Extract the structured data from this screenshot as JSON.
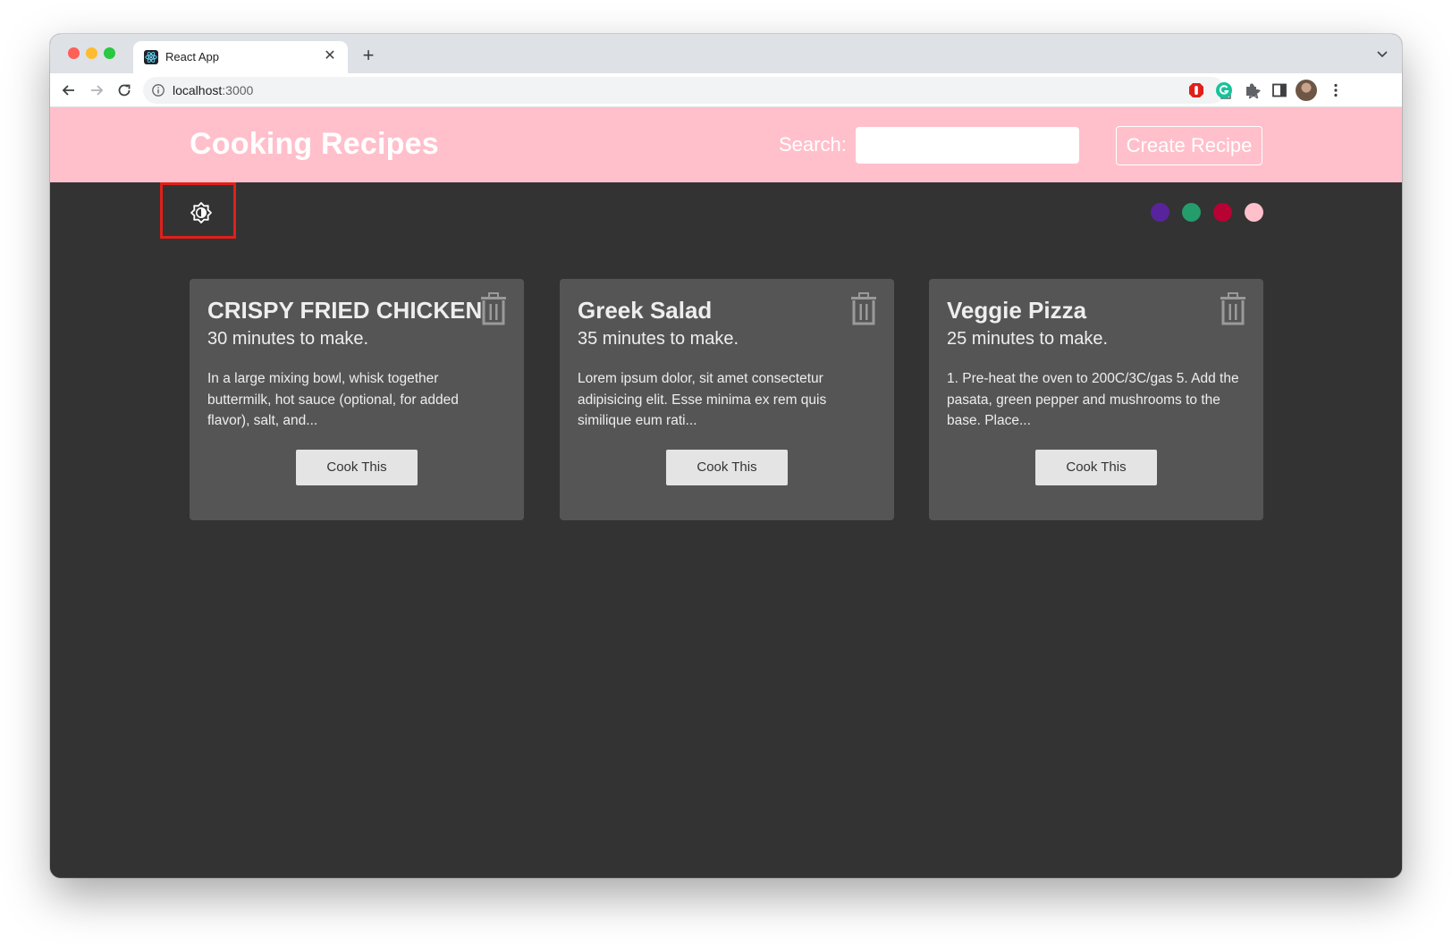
{
  "browser": {
    "tab_title": "React App",
    "url_host": "localhost",
    "url_port": ":3000"
  },
  "header": {
    "title": "Cooking Recipes",
    "search_label": "Search:",
    "search_value": "",
    "create_label": "Create Recipe",
    "bg_color": "#ffc0cb"
  },
  "theme": {
    "page_bg": "#333333",
    "card_bg": "#555555",
    "swatches": [
      "#58249c",
      "#249c6b",
      "#b70233",
      "#ffc0cb"
    ]
  },
  "recipes": [
    {
      "title": "CRISPY FRIED CHICKEN",
      "time": "30 minutes to make.",
      "snippet": "In a large mixing bowl, whisk together buttermilk, hot sauce (optional, for added flavor), salt, and...",
      "cta": "Cook This"
    },
    {
      "title": "Greek Salad",
      "time": "35 minutes to make.",
      "snippet": "Lorem ipsum dolor, sit amet consectetur adipisicing elit. Esse minima ex rem quis similique eum rati...",
      "cta": "Cook This"
    },
    {
      "title": "Veggie Pizza",
      "time": "25 minutes to make.",
      "snippet": "1. Pre-heat the oven to 200C/3C/gas 5. Add the pasata, green pepper and mushrooms to the base. Place...",
      "cta": "Cook This"
    }
  ],
  "icons": {
    "theme_toggle": "brightness-icon",
    "delete": "trash-icon",
    "back": "arrow-left-icon",
    "forward": "arrow-right-icon",
    "reload": "reload-icon"
  }
}
